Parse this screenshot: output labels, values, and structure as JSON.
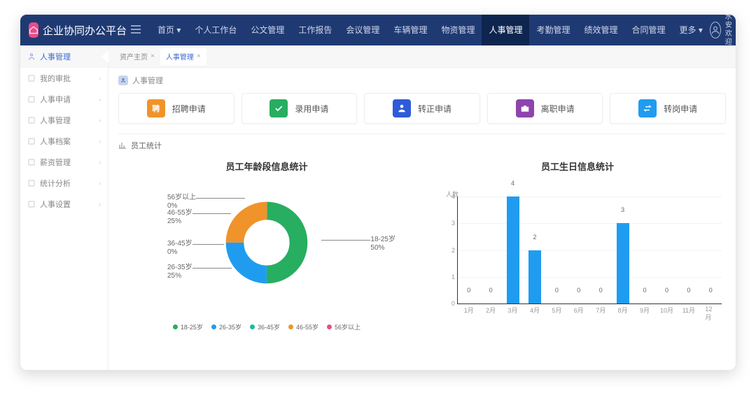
{
  "brand": "企业协同办公平台",
  "nav": [
    "首页",
    "个人工作台",
    "公文管理",
    "工作报告",
    "会议管理",
    "车辆管理",
    "物资管理",
    "人事管理",
    "考勤管理",
    "绩效管理",
    "合同管理",
    "更多"
  ],
  "nav_active": 7,
  "user": {
    "name": "古水安",
    "greeting": "欢迎您"
  },
  "sidebar": {
    "header": "人事管理",
    "items": [
      "我的审批",
      "人事申请",
      "人事管理",
      "人事档案",
      "薪资管理",
      "统计分析",
      "人事设置"
    ]
  },
  "tabs": [
    {
      "label": "资产主页",
      "active": false
    },
    {
      "label": "人事管理",
      "active": true
    }
  ],
  "section_title": "人事管理",
  "cards": [
    {
      "label": "招聘申请",
      "icon": "聘",
      "color": "#f0932b"
    },
    {
      "label": "录用申请",
      "icon": "check",
      "color": "#27ae60"
    },
    {
      "label": "转正申请",
      "icon": "person",
      "color": "#2e5bd8"
    },
    {
      "label": "离职申请",
      "icon": "case",
      "color": "#8e44ad"
    },
    {
      "label": "转岗申请",
      "icon": "swap",
      "color": "#1f9cf0"
    }
  ],
  "stat_title": "员工统计",
  "chart_data": [
    {
      "type": "pie",
      "title": "员工年龄段信息统计",
      "series": [
        {
          "name": "18-25岁",
          "value": 50,
          "color": "#27ae60"
        },
        {
          "name": "26-35岁",
          "value": 25,
          "color": "#1f9cf0"
        },
        {
          "name": "36-45岁",
          "value": 0,
          "color": "#1abc9c"
        },
        {
          "name": "46-55岁",
          "value": 25,
          "color": "#f0932b"
        },
        {
          "name": "56岁以上",
          "value": 0,
          "color": "#e84c88"
        }
      ],
      "labels": [
        {
          "name": "18-25岁",
          "pct": "50%"
        },
        {
          "name": "26-35岁",
          "pct": "25%"
        },
        {
          "name": "36-45岁",
          "pct": "0%"
        },
        {
          "name": "46-55岁",
          "pct": "25%"
        },
        {
          "name": "56岁以上",
          "pct": "0%"
        }
      ],
      "legend": [
        "18-25岁",
        "26-35岁",
        "36-45岁",
        "46-55岁",
        "56岁以上"
      ]
    },
    {
      "type": "bar",
      "title": "员工生日信息统计",
      "ylabel": "人数",
      "ylim": [
        0,
        4
      ],
      "categories": [
        "1月",
        "2月",
        "3月",
        "4月",
        "5月",
        "6月",
        "7月",
        "8月",
        "9月",
        "10月",
        "11月",
        "12月"
      ],
      "values": [
        0,
        0,
        4,
        2,
        0,
        0,
        0,
        3,
        0,
        0,
        0,
        0
      ]
    }
  ]
}
